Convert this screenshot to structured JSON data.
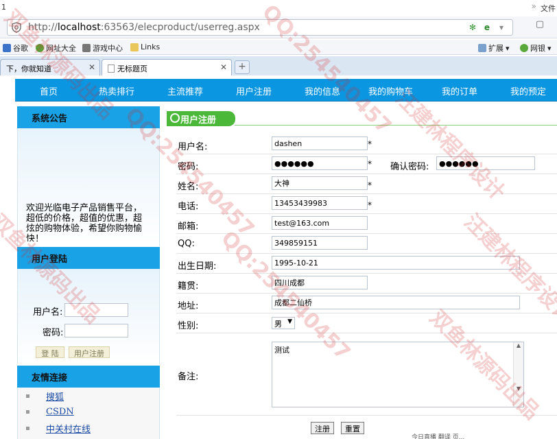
{
  "browser": {
    "title_left": "1",
    "title_right": "文件",
    "url_prefix": "http://",
    "url_host": "localhost",
    "url_rest": ":63563/elecproduct/userreg.aspx",
    "favorites": [
      "谷歌",
      "网址大全",
      "游戏中心",
      "Links"
    ],
    "fav_right": [
      "扩展",
      "网银"
    ],
    "tabs": [
      {
        "label": "下，你就知道"
      },
      {
        "label": "无标题页"
      }
    ],
    "new_tab": "+",
    "status": "今日直播    翻译    页..."
  },
  "nav": {
    "items": [
      "首页",
      "热卖排行",
      "主流推荐",
      "用户注册",
      "我的信息",
      "我的购物车",
      "我的订单",
      "我的预定"
    ]
  },
  "sidebar": {
    "notice_title": "系统公告",
    "notice_text": "欢迎光临电子产品销售平台，超低的价格，超值的优惠，超炫的购物体验，希望你购物愉快！",
    "login_title": "用户登陆",
    "username_label": "用户名:",
    "password_label": "密码:",
    "login_button": "登 陆",
    "register_button": "用户注册",
    "links_title": "友情连接",
    "links": [
      "搜狐",
      "CSDN",
      "中关村在线"
    ]
  },
  "form": {
    "section_title": "用户注册",
    "star": "*",
    "username_label": "用户名:",
    "username_value": "dashen",
    "password_label": "密码:",
    "password_value": "●●●●●●",
    "confirm_label": "确认密码:",
    "confirm_value": "●●●●●●",
    "name_label": "姓名:",
    "name_value": "大神",
    "phone_label": "电话:",
    "phone_value": "13453439983",
    "email_label": "邮箱:",
    "email_value": "test@163.com",
    "qq_label": "QQ:",
    "qq_value": "349859151",
    "birth_label": "出生日期:",
    "birth_value": "1995-10-21",
    "native_label": "籍贯:",
    "native_value": "四川成都",
    "address_label": "地址:",
    "address_value": "成都二仙桥",
    "gender_label": "性别:",
    "gender_value": "男",
    "remark_label": "备注:",
    "remark_value": "测试",
    "submit_button": "注册",
    "reset_button": "重置"
  },
  "watermark": {
    "texts": [
      "双鱼林源码出品",
      "QQ:254540457",
      "汪建林程序设计",
      "QQ:254540457",
      "双鱼林源码出品",
      "汪建林程序设计",
      "QQ:254540457",
      "双鱼林源码出品"
    ]
  }
}
